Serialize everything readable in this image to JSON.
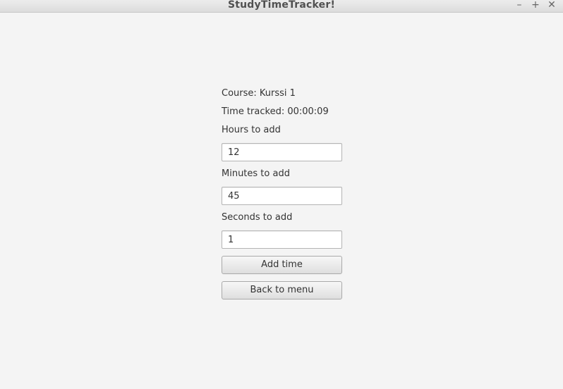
{
  "window": {
    "title": "StudyTimeTracker!",
    "controls": {
      "minimize": "–",
      "maximize": "+",
      "close": "✕"
    }
  },
  "course": {
    "label": "Course: Kurssi 1"
  },
  "time_tracked": {
    "label": "Time tracked: 00:00:09"
  },
  "hours": {
    "label": "Hours to add",
    "value": "12"
  },
  "minutes": {
    "label": "Minutes to add",
    "value": "45"
  },
  "seconds": {
    "label": "Seconds to add",
    "value": "1"
  },
  "buttons": {
    "add_time": "Add time",
    "back_to_menu": "Back to menu"
  }
}
